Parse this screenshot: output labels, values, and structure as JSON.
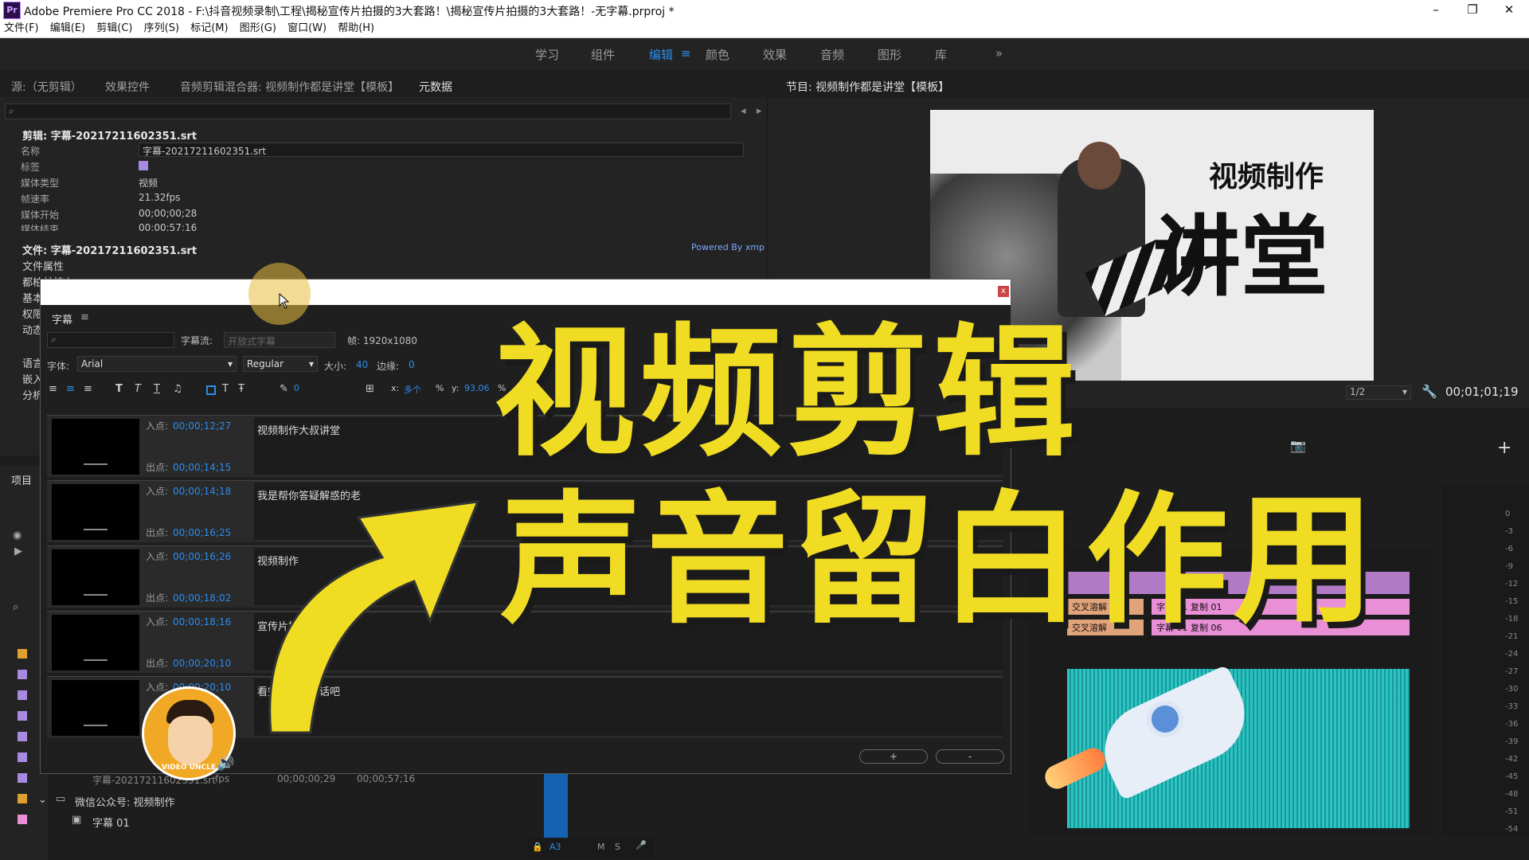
{
  "app": {
    "title": "Adobe Premiere Pro CC 2018 - F:\\抖音视频录制\\工程\\揭秘宣传片拍摄的3大套路！\\揭秘宣传片拍摄的3大套路！-无字幕.prproj *",
    "icon_label": "Pr"
  },
  "menu": [
    "文件(F)",
    "编辑(E)",
    "剪辑(C)",
    "序列(S)",
    "标记(M)",
    "图形(G)",
    "窗口(W)",
    "帮助(H)"
  ],
  "workspaces": [
    "学习",
    "组件",
    "编辑",
    "颜色",
    "效果",
    "音频",
    "图形",
    "库",
    "»"
  ],
  "source_tabs": [
    "源:（无剪辑）",
    "效果控件",
    "音频剪辑混合器: 视频制作都是讲堂【模板】",
    "元数据"
  ],
  "metadata": {
    "clip_section": "剪辑: 字幕-20217211602351.srt",
    "rows": [
      {
        "k": "名称",
        "v": "字幕-20217211602351.srt"
      },
      {
        "k": "标签",
        "v": ""
      },
      {
        "k": "媒体类型",
        "v": "视频"
      },
      {
        "k": "帧速率",
        "v": "21.32fps"
      },
      {
        "k": "媒体开始",
        "v": "00;00;00;28"
      },
      {
        "k": "媒体结束",
        "v": "00;00;57;16"
      }
    ],
    "file_section": "文件: 字幕-20217211602351.srt",
    "file_rows": [
      "文件属性",
      "都柏林核心",
      "基本",
      "权限",
      "动态",
      "语言",
      "嵌入",
      "分析"
    ],
    "xmp": "Powered By xmp"
  },
  "program": {
    "title": "节目: 视频制作都是讲堂【模板】",
    "zoom": "1/2",
    "timecode": "00;01;01;19",
    "video_text_a": "视频制作",
    "video_text_b": "讲堂"
  },
  "captions": {
    "tab": "字幕",
    "stream_label": "字幕流:",
    "stream_value": "开放式字幕",
    "frame_label": "帧: 1920x1080",
    "font_label": "字体:",
    "font": "Arial",
    "style": "Regular",
    "size_label": "大小:",
    "size": "40",
    "edge_label": "边缘:",
    "edge": "0",
    "x_label": "x:",
    "x_value": "多个",
    "pct": "%",
    "y_label": "y:",
    "y_value": "93.06",
    "in_label": "入点:",
    "out_label": "出点:",
    "items": [
      {
        "in": "00;00;12;27",
        "out": "00;00;14;15",
        "text": "视频制作大叔讲堂"
      },
      {
        "in": "00;00;14;18",
        "out": "00;00;16;25",
        "text": "我是帮你答疑解惑的老"
      },
      {
        "in": "00;00;16;26",
        "out": "00;00;18;02",
        "text": "视频制作"
      },
      {
        "in": "00;00;18;16",
        "out": "00;00;20;10",
        "text": "宣传片拍摄"
      },
      {
        "in": "00;00;20;10",
        "out": "",
        "text": "看完你就会我话吧"
      }
    ],
    "add_btn": "+",
    "remove_btn": "-"
  },
  "overlay": {
    "line1": "视频剪辑",
    "line2": "声音留白作用",
    "badge": "VIDEO UNCLE"
  },
  "project": {
    "tab": "项目",
    "row1_name": "字幕-20217211602351.srt",
    "row1_fps": "fps",
    "row1_start": "00;00;00;29",
    "row1_end": "00;00;57;16",
    "folder": "微信公众号: 视频制作",
    "item": "字幕 01"
  },
  "timeline": {
    "clips": [
      "交叉溶解",
      "字幕 01 复制 01",
      "交叉溶解",
      "字幕 01 复制 06"
    ],
    "track_labels": [
      "A3",
      "M",
      "S"
    ]
  },
  "meters": [
    "0",
    "-3",
    "-6",
    "-9",
    "-12",
    "-15",
    "-18",
    "-21",
    "-24",
    "-27",
    "-30",
    "-33",
    "-36",
    "-39",
    "-42",
    "-45",
    "-48",
    "-51",
    "-54"
  ],
  "colors": {
    "accent": "#2d8ceb",
    "overlay_yellow": "#f0dc23",
    "clip_pink": "#e98fd6",
    "audio_cyan": "#2ed6d6"
  }
}
